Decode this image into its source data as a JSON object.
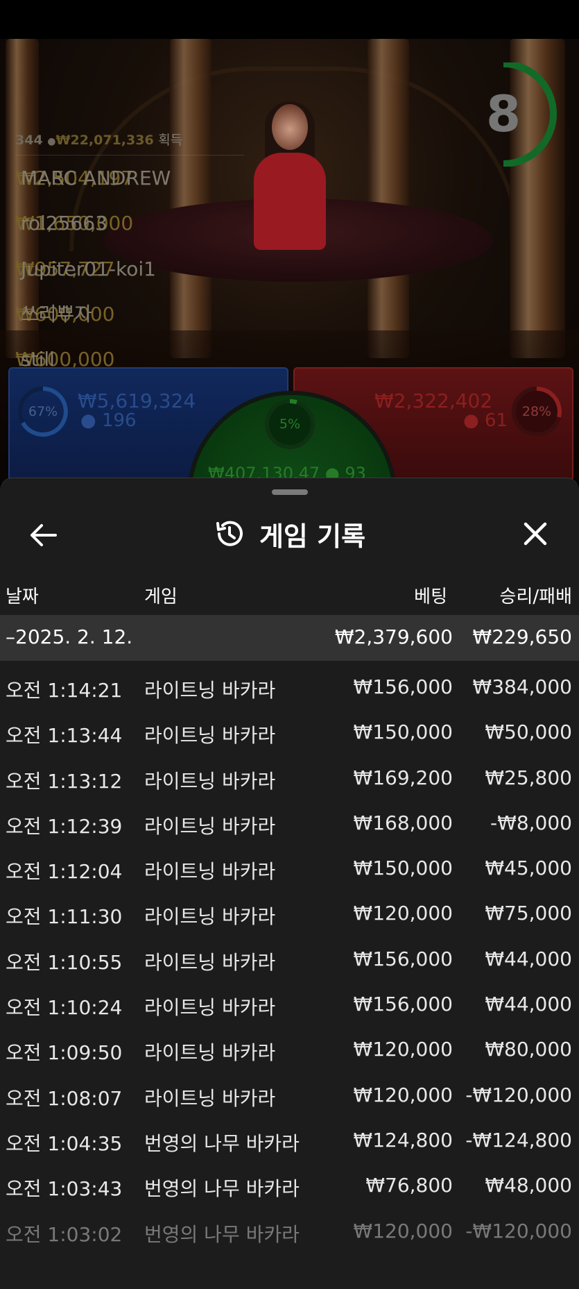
{
  "live": {
    "winners": {
      "count": "344",
      "total": "₩22,071,336",
      "label": "획득",
      "list": [
        {
          "amount": "₩2,504,197",
          "name": "MARC ANDREW"
        },
        {
          "amount": "₩1,650,000",
          "name": "rol25663"
        },
        {
          "amount": "₩957,727",
          "name": "Jupiter01-koi1"
        },
        {
          "amount": "₩600,000",
          "name": "쓰러뿌자"
        },
        {
          "amount": "₩600,000",
          "name": "still"
        }
      ]
    },
    "timer": "8",
    "player": {
      "percent": "67%",
      "amount": "₩5,619,324",
      "count": "196"
    },
    "banker": {
      "percent": "28%",
      "amount": "₩2,322,402",
      "count": "61"
    },
    "tie": {
      "percent": "5%",
      "amount": "₩407,130.47",
      "count": "93"
    },
    "colors": {
      "player": "#4a8aff",
      "banker": "#ff3a3a",
      "tie": "#48e04a",
      "timer": "#22c24a"
    }
  },
  "history": {
    "title": "게임 기록",
    "columns": {
      "date": "날짜",
      "game": "게임",
      "bet": "베팅",
      "result": "승리/패배"
    },
    "day": {
      "label": "–2025. 2. 12.",
      "bet_total": "₩2,379,600",
      "result_total": "₩229,650"
    },
    "rows": [
      {
        "time": "오전 1:14:21",
        "game": "라이트닝 바카라",
        "bet": "₩156,000",
        "result": "₩384,000"
      },
      {
        "time": "오전 1:13:44",
        "game": "라이트닝 바카라",
        "bet": "₩150,000",
        "result": "₩50,000"
      },
      {
        "time": "오전 1:13:12",
        "game": "라이트닝 바카라",
        "bet": "₩169,200",
        "result": "₩25,800"
      },
      {
        "time": "오전 1:12:39",
        "game": "라이트닝 바카라",
        "bet": "₩168,000",
        "result": "-₩8,000"
      },
      {
        "time": "오전 1:12:04",
        "game": "라이트닝 바카라",
        "bet": "₩150,000",
        "result": "₩45,000"
      },
      {
        "time": "오전 1:11:30",
        "game": "라이트닝 바카라",
        "bet": "₩120,000",
        "result": "₩75,000"
      },
      {
        "time": "오전 1:10:55",
        "game": "라이트닝 바카라",
        "bet": "₩156,000",
        "result": "₩44,000"
      },
      {
        "time": "오전 1:10:24",
        "game": "라이트닝 바카라",
        "bet": "₩156,000",
        "result": "₩44,000"
      },
      {
        "time": "오전 1:09:50",
        "game": "라이트닝 바카라",
        "bet": "₩120,000",
        "result": "₩80,000"
      },
      {
        "time": "오전 1:08:07",
        "game": "라이트닝 바카라",
        "bet": "₩120,000",
        "result": "-₩120,000"
      },
      {
        "time": "오전 1:04:35",
        "game": "번영의 나무 바카라",
        "bet": "₩124,800",
        "result": "-₩124,800"
      },
      {
        "time": "오전 1:03:43",
        "game": "번영의 나무 바카라",
        "bet": "₩76,800",
        "result": "₩48,000"
      },
      {
        "time": "오전 1:03:02",
        "game": "번영의 나무 바카라",
        "bet": "₩120,000",
        "result": "-₩120,000"
      }
    ]
  }
}
